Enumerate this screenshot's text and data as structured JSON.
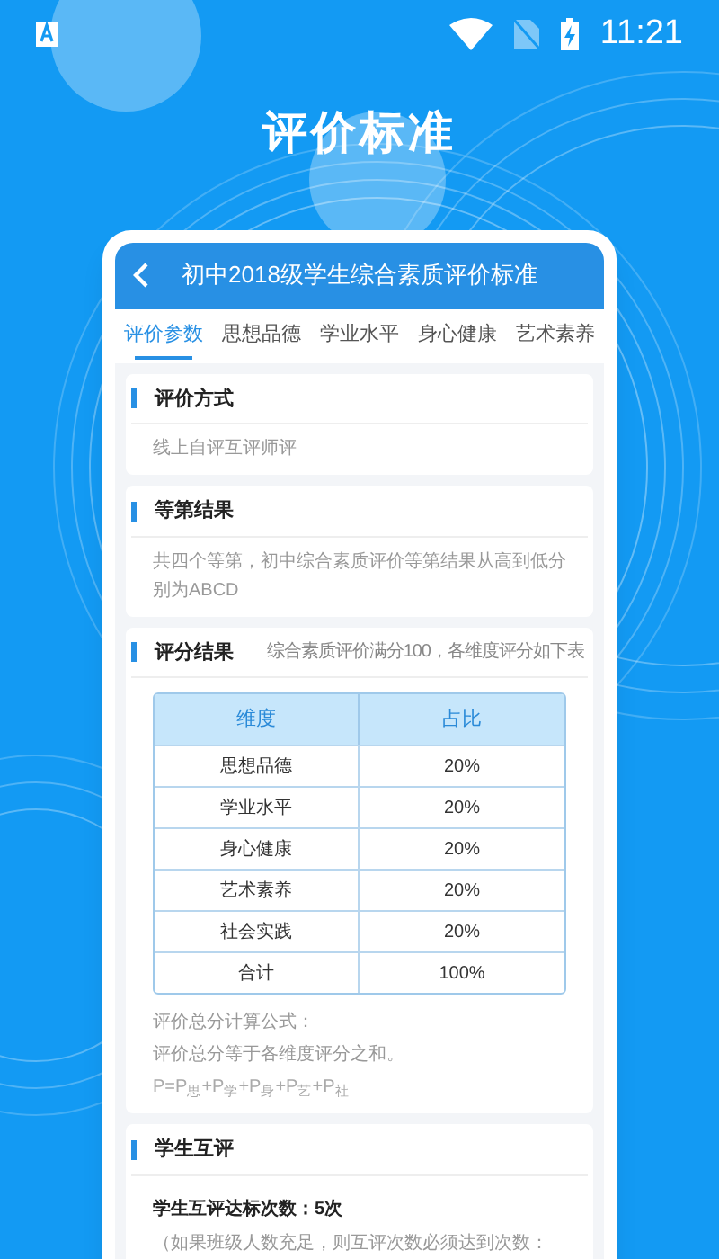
{
  "status_bar": {
    "time": "11:21"
  },
  "page_title": "评价标准",
  "app": {
    "title": "初中2018级学生综合素质评价标准",
    "tabs": [
      {
        "label": "评价参数",
        "selected": true
      },
      {
        "label": "思想品德",
        "selected": false
      },
      {
        "label": "学业水平",
        "selected": false
      },
      {
        "label": "身心健康",
        "selected": false
      },
      {
        "label": "艺术素养",
        "selected": false
      }
    ],
    "sections": [
      {
        "title": "评价方式",
        "blocks": [
          {
            "kind": "paragraph",
            "text": "线上自评互评师评"
          }
        ]
      },
      {
        "title": "等第结果",
        "blocks": [
          {
            "kind": "paragraph",
            "text": "共四个等第，初中综合素质评价等第结果从高到低分别为ABCD"
          }
        ]
      },
      {
        "title": "评分结果",
        "note": "综合素质评价满分100，各维度评分如下表",
        "blocks": [
          {
            "kind": "table",
            "columns": [
              "维度",
              "占比"
            ],
            "rows": [
              [
                "思想品德",
                "20%"
              ],
              [
                "学业水平",
                "20%"
              ],
              [
                "身心健康",
                "20%"
              ],
              [
                "艺术素养",
                "20%"
              ],
              [
                "社会实践",
                "20%"
              ],
              [
                "合计",
                "100%"
              ]
            ]
          },
          {
            "kind": "paragraph",
            "text": "评价总分计算公式："
          },
          {
            "kind": "paragraph",
            "text": "评价总分等于各维度评分之和。"
          },
          {
            "kind": "formula",
            "text": "P=P$_{思}$+P$_{学}$+P$_{身}$+P$_{艺}$+P$_{社}$"
          }
        ]
      },
      {
        "title": "学生互评",
        "blocks": [
          {
            "kind": "emphasis",
            "text": "学生互评达标次数：5次"
          },
          {
            "kind": "paragraph",
            "text": "（如果班级人数充足，则互评次数必须达到次数："
          }
        ]
      }
    ]
  }
}
